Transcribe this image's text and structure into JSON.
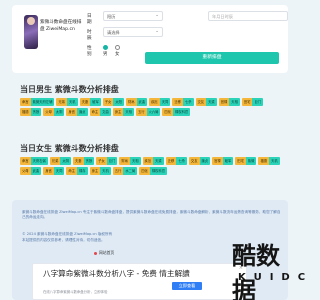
{
  "logo": {
    "text": "紫微斗数命盘在线排盘 ZiweiMap.cn"
  },
  "form": {
    "birthday_label": "日期",
    "year_value": "阳历",
    "date_placeholder": "年月日时辰",
    "time_label": "时辰",
    "time_value": "请选择",
    "sex_label": "性别",
    "male": "男",
    "female": "女",
    "submit": "重新排盘"
  },
  "male_section": {
    "title": "当日男生 紫微斗数分析排盘",
    "tags": [
      {
        "k": "命宫",
        "v": "紫微天府左辅"
      },
      {
        "k": "兄弟",
        "v": "天机"
      },
      {
        "k": "夫妻",
        "v": "破军"
      },
      {
        "k": "子女",
        "v": "太阳"
      },
      {
        "k": "财帛",
        "v": "武曲"
      },
      {
        "k": "疾厄",
        "v": "天同"
      },
      {
        "k": "迁移",
        "v": "七杀"
      },
      {
        "k": "交友",
        "v": "天梁"
      },
      {
        "k": "官禄",
        "v": "天相"
      },
      {
        "k": "田宅",
        "v": "巨门"
      },
      {
        "k": "福德",
        "v": "贪狼"
      },
      {
        "k": "父母",
        "v": "太阴"
      },
      {
        "k": "身宫",
        "v": "廉贞"
      },
      {
        "k": "命主",
        "v": "文曲"
      },
      {
        "k": "身主",
        "v": "天相"
      },
      {
        "k": "五行",
        "v": "火六局"
      },
      {
        "k": "四化",
        "v": "禄权科忌"
      }
    ]
  },
  "female_section": {
    "title": "当日女生 紫微斗数分析排盘",
    "tags": [
      {
        "k": "命宫",
        "v": "天府右弼"
      },
      {
        "k": "兄弟",
        "v": "太阴"
      },
      {
        "k": "夫妻",
        "v": "贪狼"
      },
      {
        "k": "子女",
        "v": "巨门"
      },
      {
        "k": "财帛",
        "v": "天相"
      },
      {
        "k": "疾厄",
        "v": "天梁"
      },
      {
        "k": "迁移",
        "v": "七杀"
      },
      {
        "k": "交友",
        "v": "廉贞"
      },
      {
        "k": "官禄",
        "v": "破军"
      },
      {
        "k": "田宅",
        "v": "紫微"
      },
      {
        "k": "福德",
        "v": "天机"
      },
      {
        "k": "父母",
        "v": "武曲"
      },
      {
        "k": "身宫",
        "v": "天同"
      },
      {
        "k": "命主",
        "v": "禄存"
      },
      {
        "k": "身主",
        "v": "天机"
      },
      {
        "k": "五行",
        "v": "水二局"
      },
      {
        "k": "四化",
        "v": "禄权科忌"
      }
    ]
  },
  "footer": {
    "line1": "紫微斗数命盘在线排盘 ZiweiMap.cn 专注于紫微斗数命盘排盘，提供紫微斗数命盘在线免费排盘，紫微斗数命盘解析、紫微斗数流年运势查询等服务，助您了解自己的命运走向。",
    "line2": "© 2024 紫微斗数命盘在线排盘 ZiweiMap.cn 版权所有",
    "line3": "本站提供的内容仅供参考，请理性对待，切勿迷信。",
    "link": "网站首页"
  },
  "ad": {
    "title": "八字算命紫微斗数分析八字 - 免费 情主解讀",
    "sub": "在线八字算命紫微斗数命盘分析，立即体验",
    "button": "立即查看"
  },
  "watermark": {
    "main": "酷数据",
    "sub": "KUIDC"
  }
}
